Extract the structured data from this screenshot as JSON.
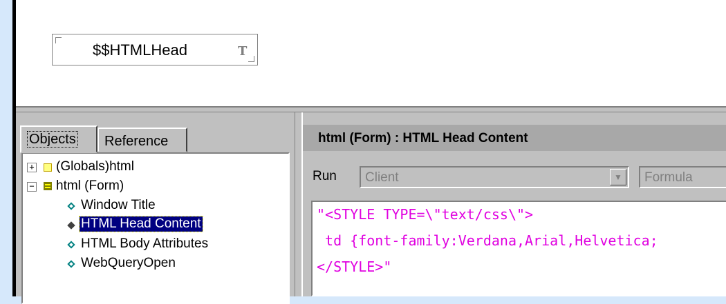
{
  "design": {
    "field_name": "$$HTMLHead",
    "field_type_glyph": "T"
  },
  "left_panel": {
    "tabs": [
      {
        "label": "Objects",
        "active": true
      },
      {
        "label": "Reference",
        "active": false
      }
    ],
    "tree": [
      {
        "label": "(Globals)html",
        "expander": "+",
        "icon": "globals-icon"
      },
      {
        "label": "html (Form)",
        "expander": "−",
        "icon": "form-icon"
      },
      {
        "label": "Window Title",
        "icon": "event-diamond-icon"
      },
      {
        "label": "HTML Head Content",
        "icon": "event-diamond-filled-icon",
        "selected": true
      },
      {
        "label": "HTML Body Attributes",
        "icon": "event-diamond-icon"
      },
      {
        "label": "WebQueryOpen",
        "icon": "event-diamond-icon"
      }
    ]
  },
  "right_panel": {
    "header_title": "html (Form) : HTML Head Content",
    "run_label": "Run",
    "run_value": "Client",
    "language_value": "Formula",
    "code_lines": [
      "\"<STYLE TYPE=\\\"text/css\\\">",
      " td {font-family:Verdana,Arial,Helvetica;",
      "</STYLE>\""
    ]
  },
  "colors": {
    "code_text": "#e000e0",
    "selection": "#000080",
    "background": "#d6e8fb"
  }
}
